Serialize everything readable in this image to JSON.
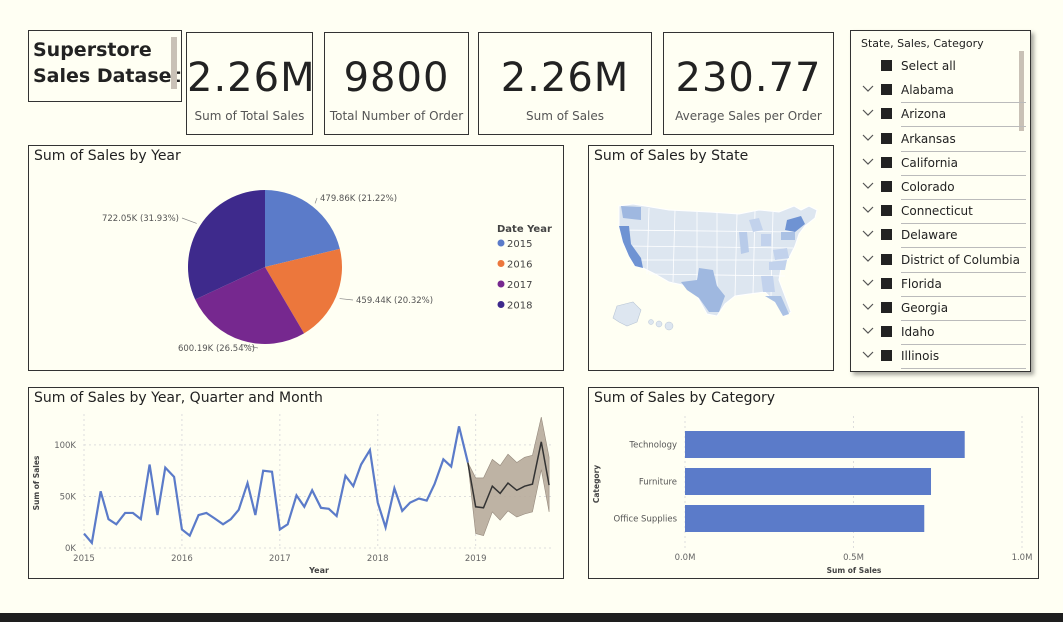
{
  "header": {
    "title_line1": "Superstore",
    "title_line2": "Sales Dataset"
  },
  "cards": [
    {
      "value": "2.26M",
      "label": "Sum of Total Sales"
    },
    {
      "value": "9800",
      "label": "Total Number of Order"
    },
    {
      "value": "2.26M",
      "label": "Sum of Sales"
    },
    {
      "value": "230.77",
      "label": "Average Sales per Order"
    }
  ],
  "slicer": {
    "title": "State, Sales, Category",
    "items": [
      "Select all",
      "Alabama",
      "Arizona",
      "Arkansas",
      "California",
      "Colorado",
      "Connecticut",
      "Delaware",
      "District of Columbia",
      "Florida",
      "Georgia",
      "Idaho",
      "Illinois"
    ]
  },
  "panels": {
    "pie_title": "Sum of Sales by Year",
    "map_title": "Sum of Sales by State",
    "line_title": "Sum of Sales by Year, Quarter and Month",
    "bar_title": "Sum of Sales by Category"
  },
  "colors": {
    "c2015": "#5b7bc9",
    "c2016": "#ec773c",
    "c2017": "#76288f",
    "c2018": "#3e2a8c",
    "bar": "#5b7bc9",
    "line": "#5b7bc9"
  },
  "chart_data": [
    {
      "type": "pie",
      "title": "Sum of Sales by Year",
      "legend_title": "Date Year",
      "legend_position": "right",
      "slices": [
        {
          "name": "2015",
          "value": 479.86,
          "label": "479.86K (21.22%)",
          "pct": 21.22
        },
        {
          "name": "2016",
          "value": 459.44,
          "label": "459.44K (20.32%)",
          "pct": 20.32
        },
        {
          "name": "2017",
          "value": 600.19,
          "label": "600.19K (26.54%)",
          "pct": 26.54
        },
        {
          "name": "2018",
          "value": 722.05,
          "label": "722.05K (31.93%)",
          "pct": 31.93
        }
      ]
    },
    {
      "type": "line",
      "title": "Sum of Sales by Year, Quarter and Month",
      "xlabel": "Year",
      "ylabel": "Sum of Sales",
      "x_ticks": [
        "2015",
        "2016",
        "2017",
        "2018",
        "2019"
      ],
      "y_ticks": [
        "0K",
        "50K",
        "100K"
      ],
      "ylim": [
        0,
        130000
      ],
      "xlim": [
        2015,
        2019.8
      ],
      "grid": true,
      "actual": [
        [
          2015.0,
          14000
        ],
        [
          2015.08,
          5000
        ],
        [
          2015.17,
          55000
        ],
        [
          2015.25,
          28000
        ],
        [
          2015.33,
          23000
        ],
        [
          2015.42,
          34000
        ],
        [
          2015.5,
          34000
        ],
        [
          2015.58,
          28000
        ],
        [
          2015.67,
          81000
        ],
        [
          2015.75,
          32000
        ],
        [
          2015.83,
          78000
        ],
        [
          2015.92,
          69000
        ],
        [
          2016.0,
          18000
        ],
        [
          2016.08,
          12000
        ],
        [
          2016.17,
          32000
        ],
        [
          2016.25,
          34000
        ],
        [
          2016.33,
          29000
        ],
        [
          2016.42,
          23000
        ],
        [
          2016.5,
          28000
        ],
        [
          2016.58,
          37000
        ],
        [
          2016.67,
          63000
        ],
        [
          2016.75,
          32000
        ],
        [
          2016.83,
          75000
        ],
        [
          2016.92,
          74000
        ],
        [
          2017.0,
          18000
        ],
        [
          2017.08,
          23000
        ],
        [
          2017.17,
          51000
        ],
        [
          2017.25,
          40000
        ],
        [
          2017.33,
          56000
        ],
        [
          2017.42,
          39000
        ],
        [
          2017.5,
          38000
        ],
        [
          2017.58,
          31000
        ],
        [
          2017.67,
          70000
        ],
        [
          2017.75,
          60000
        ],
        [
          2017.83,
          81000
        ],
        [
          2017.92,
          95000
        ],
        [
          2018.0,
          44000
        ],
        [
          2018.08,
          20000
        ],
        [
          2018.17,
          58000
        ],
        [
          2018.25,
          36000
        ],
        [
          2018.33,
          44000
        ],
        [
          2018.42,
          48000
        ],
        [
          2018.5,
          46000
        ],
        [
          2018.58,
          62000
        ],
        [
          2018.67,
          86000
        ],
        [
          2018.75,
          79000
        ],
        [
          2018.83,
          118000
        ],
        [
          2018.92,
          83000
        ]
      ],
      "forecast": [
        [
          2018.92,
          83000
        ],
        [
          2019.0,
          40000
        ],
        [
          2019.08,
          39000
        ],
        [
          2019.17,
          60000
        ],
        [
          2019.25,
          53000
        ],
        [
          2019.33,
          63000
        ],
        [
          2019.42,
          56000
        ],
        [
          2019.5,
          60000
        ],
        [
          2019.58,
          62000
        ],
        [
          2019.67,
          103000
        ],
        [
          2019.75,
          61000
        ]
      ],
      "forecast_upper": [
        [
          2018.92,
          83000
        ],
        [
          2019.0,
          68000
        ],
        [
          2019.08,
          68000
        ],
        [
          2019.17,
          86000
        ],
        [
          2019.25,
          80000
        ],
        [
          2019.33,
          91000
        ],
        [
          2019.42,
          83000
        ],
        [
          2019.5,
          88000
        ],
        [
          2019.58,
          90000
        ],
        [
          2019.67,
          127000
        ],
        [
          2019.75,
          88000
        ]
      ],
      "forecast_lower": [
        [
          2018.92,
          83000
        ],
        [
          2019.0,
          14000
        ],
        [
          2019.08,
          12000
        ],
        [
          2019.17,
          35000
        ],
        [
          2019.25,
          27000
        ],
        [
          2019.33,
          36000
        ],
        [
          2019.42,
          30000
        ],
        [
          2019.5,
          33000
        ],
        [
          2019.58,
          35000
        ],
        [
          2019.67,
          76000
        ],
        [
          2019.75,
          35000
        ]
      ]
    },
    {
      "type": "bar",
      "orientation": "horizontal",
      "title": "Sum of Sales by Category",
      "categories": [
        "Technology",
        "Furniture",
        "Office Supplies"
      ],
      "values": [
        0.83,
        0.73,
        0.71
      ],
      "xlabel": "Sum of Sales",
      "ylabel": "Category",
      "x_ticks": [
        "0.0M",
        "0.5M",
        "1.0M"
      ],
      "xlim": [
        0,
        1.0
      ],
      "grid": true
    }
  ]
}
